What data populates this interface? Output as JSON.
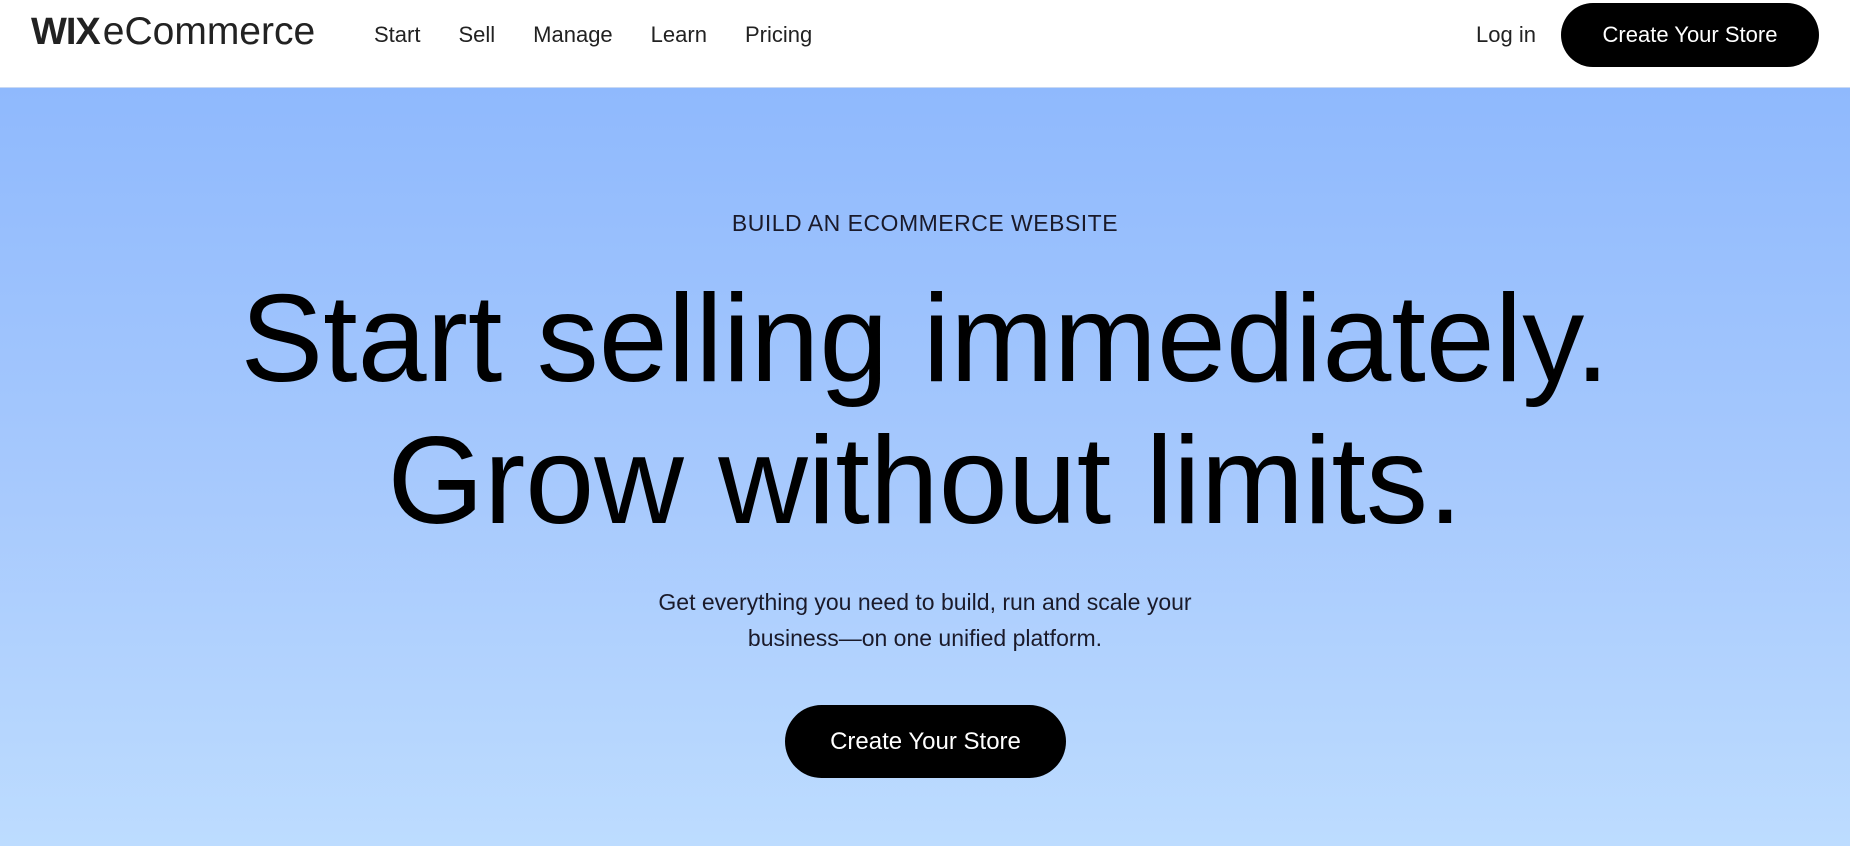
{
  "header": {
    "logo": {
      "brand": "WIX",
      "product": "eCommerce"
    },
    "nav": [
      "Start",
      "Sell",
      "Manage",
      "Learn",
      "Pricing"
    ],
    "login_label": "Log in",
    "cta_label": "Create Your Store"
  },
  "hero": {
    "eyebrow": "BUILD AN ECOMMERCE WEBSITE",
    "headline_line1": "Start selling immediately.",
    "headline_line2": "Grow without limits.",
    "sub_line1": "Get everything you need to build, run and scale your",
    "sub_line2": "business—on one unified platform.",
    "cta_label": "Create Your Store"
  },
  "colors": {
    "accent_button": "#000000",
    "hero_gradient_top": "#8fb9fd",
    "hero_gradient_bottom": "#bddcff"
  }
}
